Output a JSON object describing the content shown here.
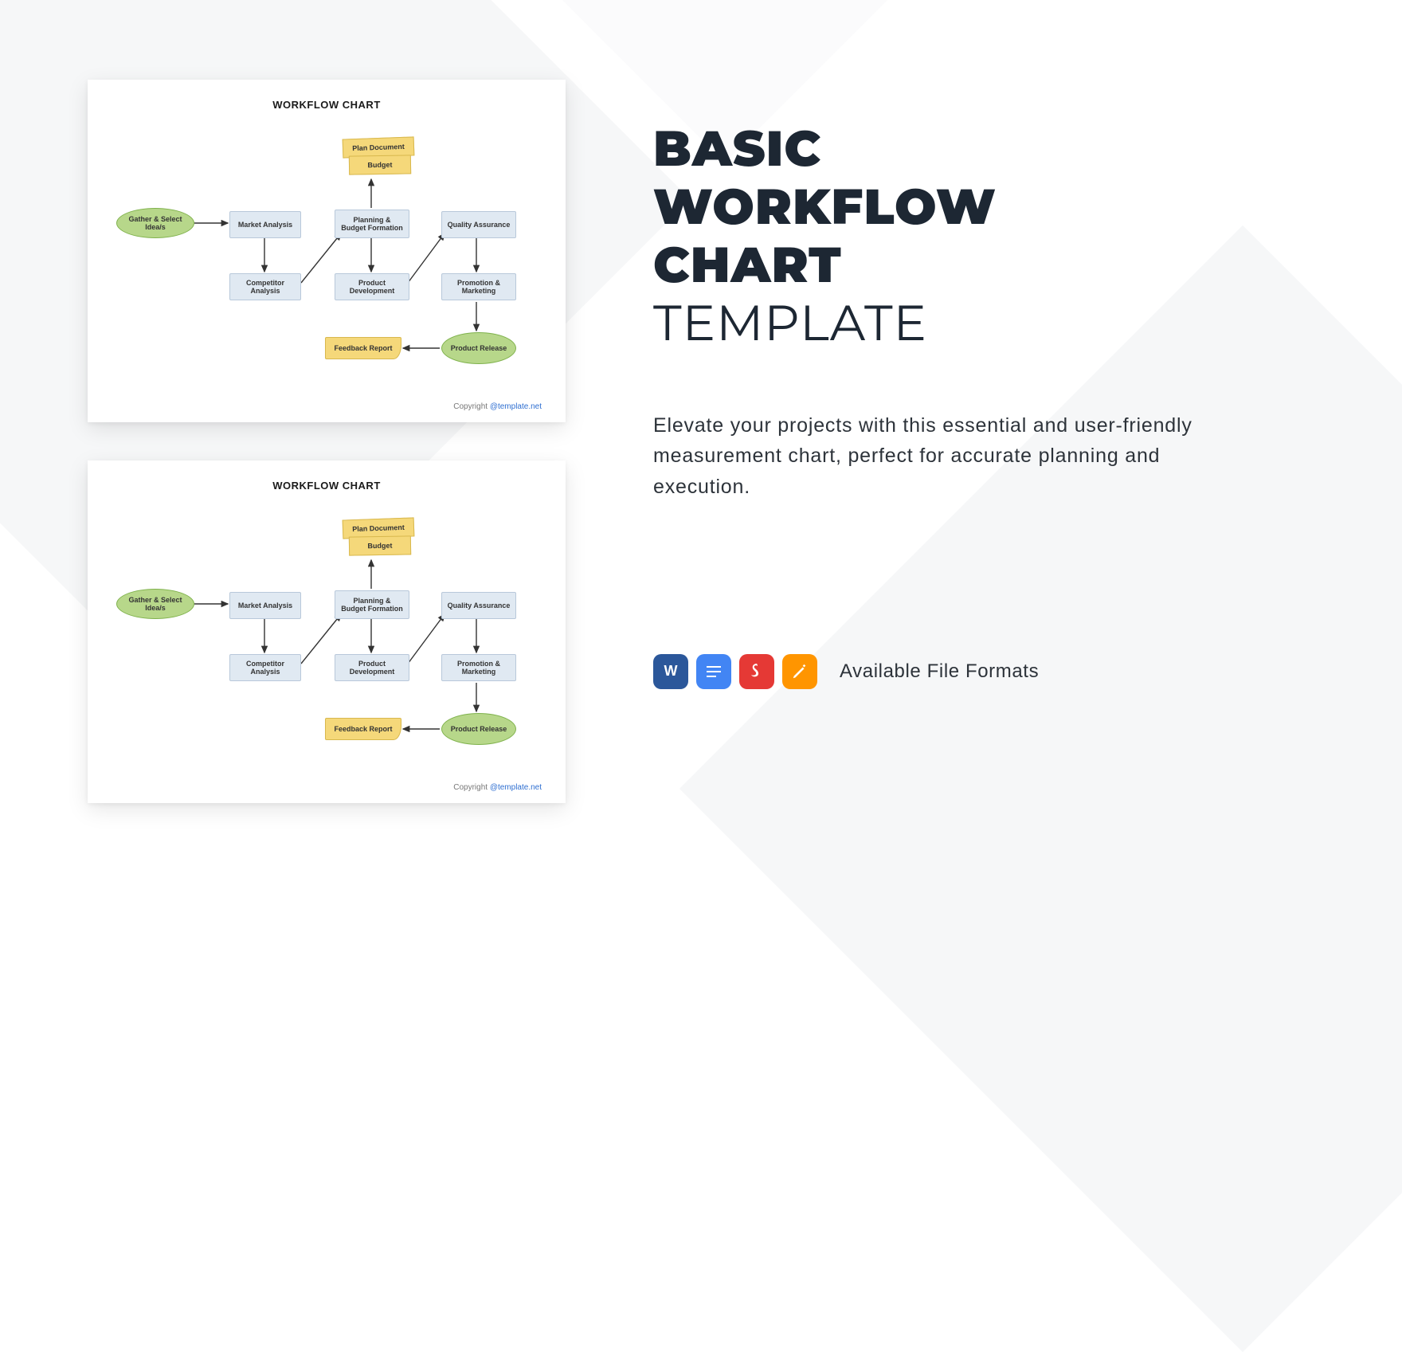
{
  "heading": {
    "line1": "BASIC",
    "line2": "WORKFLOW",
    "line3": "CHART",
    "line4": "TEMPLATE"
  },
  "description": "Elevate your projects with this essential and user-friendly measurement chart, perfect for accurate planning and execution.",
  "formats_label": "Available File Formats",
  "format_icons": {
    "word": "W",
    "gdoc": "gdoc",
    "pdf": "pdf",
    "pages": "pages"
  },
  "preview": {
    "title": "WORKFLOW CHART",
    "copyright_prefix": "Copyright ",
    "copyright_link": "@template.net",
    "nodes": {
      "gather": "Gather & Select Idea/s",
      "market": "Market Analysis",
      "competitor": "Competitor Analysis",
      "plan_doc": "Plan Document",
      "budget": "Budget",
      "planning": "Planning & Budget Formation",
      "product_dev": "Product Development",
      "qa": "Quality Assurance",
      "promo": "Promotion & Marketing",
      "release": "Product Release",
      "feedback": "Feedback Report"
    }
  }
}
